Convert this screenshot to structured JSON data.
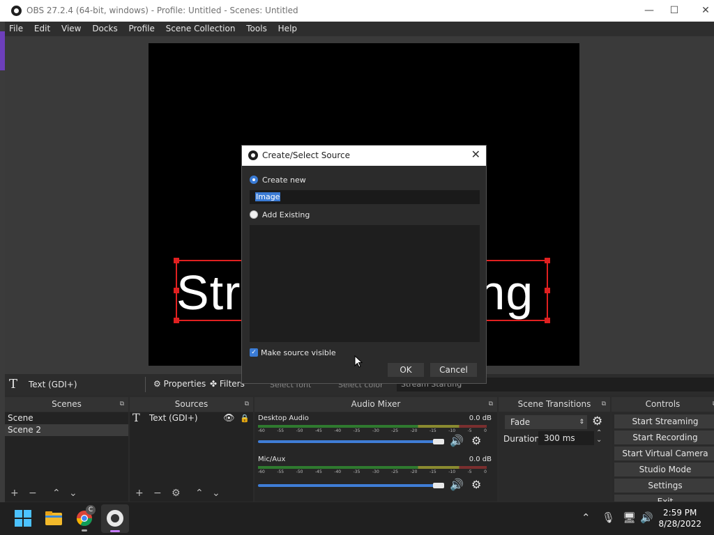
{
  "window": {
    "title": "OBS 27.2.4 (64-bit, windows) - Profile: Untitled - Scenes: Untitled",
    "minimize": "—",
    "maximize": "☐",
    "close": "✕"
  },
  "menu": [
    "File",
    "Edit",
    "View",
    "Docks",
    "Profile",
    "Scene Collection",
    "Tools",
    "Help"
  ],
  "preview": {
    "text_left": "Str",
    "text_right": "ng"
  },
  "source_toolbar": {
    "source_name": "Text (GDI+)",
    "properties": "Properties",
    "filters": "Filters",
    "select_font": "Select font",
    "select_color": "Select color",
    "text_value": "Stream Starting"
  },
  "scenes": {
    "title": "Scenes",
    "items": [
      "Scene",
      "Scene 2"
    ],
    "selected": "Scene 2"
  },
  "sources": {
    "title": "Sources",
    "items": [
      {
        "name": "Text (GDI+)"
      }
    ]
  },
  "audio_mixer": {
    "title": "Audio Mixer",
    "channels": [
      {
        "name": "Desktop Audio",
        "db": "0.0 dB",
        "volume": 1.0
      },
      {
        "name": "Mic/Aux",
        "db": "0.0 dB",
        "volume": 1.0
      }
    ],
    "ticks": [
      "-60",
      "-55",
      "-50",
      "-45",
      "-40",
      "-35",
      "-30",
      "-25",
      "-20",
      "-15",
      "-10",
      "-5",
      "0"
    ]
  },
  "transitions": {
    "title": "Scene Transitions",
    "type": "Fade",
    "duration_label": "Duration",
    "duration_value": "300 ms"
  },
  "controls": {
    "title": "Controls",
    "buttons": [
      "Start Streaming",
      "Start Recording",
      "Start Virtual Camera",
      "Studio Mode",
      "Settings",
      "Exit"
    ]
  },
  "dialog": {
    "title": "Create/Select Source",
    "create_new": "Create new",
    "name_value": "Image",
    "add_existing": "Add Existing",
    "make_visible": "Make source visible",
    "ok": "OK",
    "cancel": "Cancel"
  },
  "taskbar": {
    "time": "2:59 PM",
    "date": "8/28/2022",
    "chrome_badge": "C"
  },
  "colors": {
    "accent": "#3a7bd5",
    "selection_red": "#e02020",
    "purple_strip": "#6d3fbb"
  }
}
